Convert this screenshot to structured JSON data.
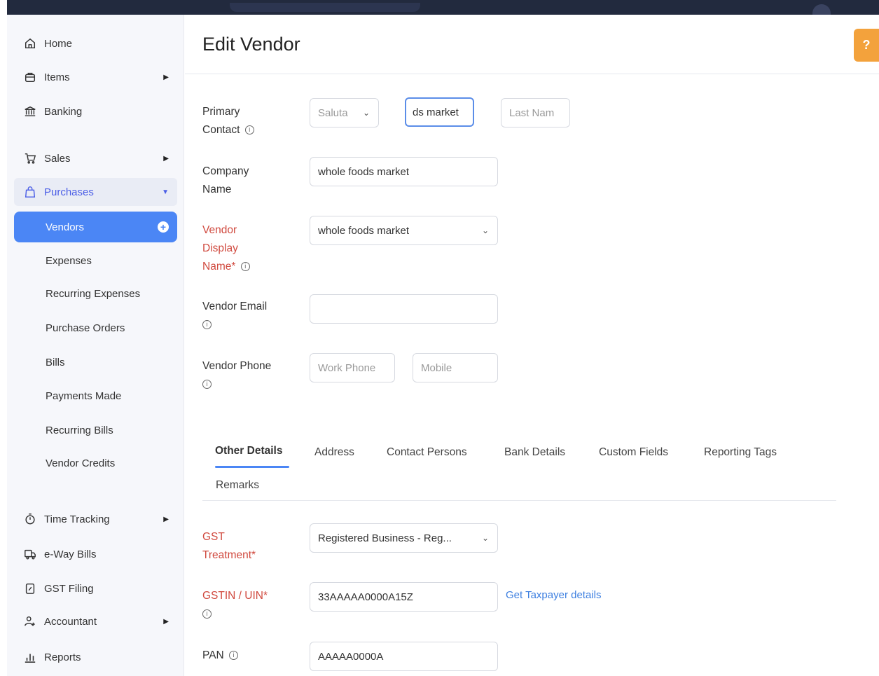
{
  "sidebar": {
    "home": "Home",
    "items": "Items",
    "banking": "Banking",
    "sales": "Sales",
    "purchases": "Purchases",
    "purchases_sub": [
      "Vendors",
      "Expenses",
      "Recurring Expenses",
      "Purchase Orders",
      "Bills",
      "Payments Made",
      "Recurring Bills",
      "Vendor Credits"
    ],
    "time_tracking": "Time Tracking",
    "eway_bills": "e-Way Bills",
    "gst_filing": "GST Filing",
    "accountant": "Accountant",
    "reports": "Reports"
  },
  "header": {
    "title": "Edit Vendor",
    "help": "?"
  },
  "form": {
    "primary_contact_label": "Primary Contact",
    "salutation": "Saluta",
    "first_name": "ds market",
    "last_name_placeholder": "Last Nam",
    "company_label": "Company Name",
    "company_value": "whole foods market",
    "display_name_label": "Vendor Display Name*",
    "display_name_value": "whole foods market",
    "email_label": "Vendor Email",
    "email_value": "",
    "phone_label": "Vendor Phone",
    "work_phone_placeholder": "Work Phone",
    "mobile_placeholder": "Mobile"
  },
  "tabs": [
    "Other Details",
    "Address",
    "Contact Persons",
    "Bank Details",
    "Custom Fields",
    "Reporting Tags",
    "Remarks"
  ],
  "other": {
    "gst_treatment_label": "GST Treatment*",
    "gst_treatment_value": "Registered Business - Reg...",
    "gstin_label": "GSTIN / UIN*",
    "gstin_value": "33AAAAA0000A15Z",
    "get_taxpayer": "Get Taxpayer details",
    "pan_label": "PAN",
    "pan_value": "AAAAA0000A"
  }
}
